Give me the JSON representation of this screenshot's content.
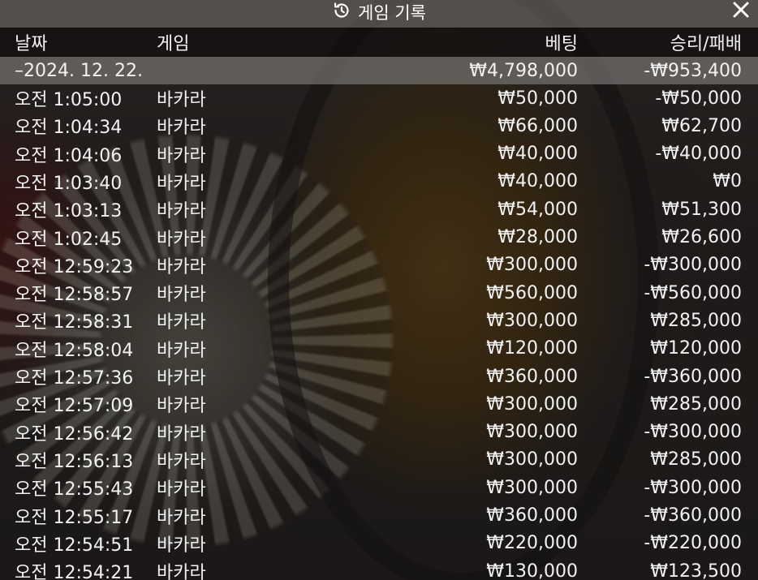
{
  "dialog": {
    "title": "게임 기록",
    "history_icon": "history-icon",
    "close_icon": "close-icon"
  },
  "columns": {
    "date": "날짜",
    "game": "게임",
    "bet": "베팅",
    "result": "승리/패배"
  },
  "group": {
    "date": "–2024. 12. 22.",
    "bet": "₩4,798,000",
    "result": "-₩953,400"
  },
  "rows": [
    {
      "time": "오전 1:05:00",
      "game": "바카라",
      "bet": "₩50,000",
      "result": "-₩50,000"
    },
    {
      "time": "오전 1:04:34",
      "game": "바카라",
      "bet": "₩66,000",
      "result": "₩62,700"
    },
    {
      "time": "오전 1:04:06",
      "game": "바카라",
      "bet": "₩40,000",
      "result": "-₩40,000"
    },
    {
      "time": "오전 1:03:40",
      "game": "바카라",
      "bet": "₩40,000",
      "result": "₩0"
    },
    {
      "time": "오전 1:03:13",
      "game": "바카라",
      "bet": "₩54,000",
      "result": "₩51,300"
    },
    {
      "time": "오전 1:02:45",
      "game": "바카라",
      "bet": "₩28,000",
      "result": "₩26,600"
    },
    {
      "time": "오전 12:59:23",
      "game": "바카라",
      "bet": "₩300,000",
      "result": "-₩300,000"
    },
    {
      "time": "오전 12:58:57",
      "game": "바카라",
      "bet": "₩560,000",
      "result": "-₩560,000"
    },
    {
      "time": "오전 12:58:31",
      "game": "바카라",
      "bet": "₩300,000",
      "result": "₩285,000"
    },
    {
      "time": "오전 12:58:04",
      "game": "바카라",
      "bet": "₩120,000",
      "result": "₩120,000"
    },
    {
      "time": "오전 12:57:36",
      "game": "바카라",
      "bet": "₩360,000",
      "result": "-₩360,000"
    },
    {
      "time": "오전 12:57:09",
      "game": "바카라",
      "bet": "₩300,000",
      "result": "₩285,000"
    },
    {
      "time": "오전 12:56:42",
      "game": "바카라",
      "bet": "₩300,000",
      "result": "-₩300,000"
    },
    {
      "time": "오전 12:56:13",
      "game": "바카라",
      "bet": "₩300,000",
      "result": "₩285,000"
    },
    {
      "time": "오전 12:55:43",
      "game": "바카라",
      "bet": "₩300,000",
      "result": "-₩300,000"
    },
    {
      "time": "오전 12:55:17",
      "game": "바카라",
      "bet": "₩360,000",
      "result": "-₩360,000"
    },
    {
      "time": "오전 12:54:51",
      "game": "바카라",
      "bet": "₩220,000",
      "result": "-₩220,000"
    },
    {
      "time": "오전 12:54:21",
      "game": "바카라",
      "bet": "₩130,000",
      "result": "₩123,500"
    }
  ]
}
